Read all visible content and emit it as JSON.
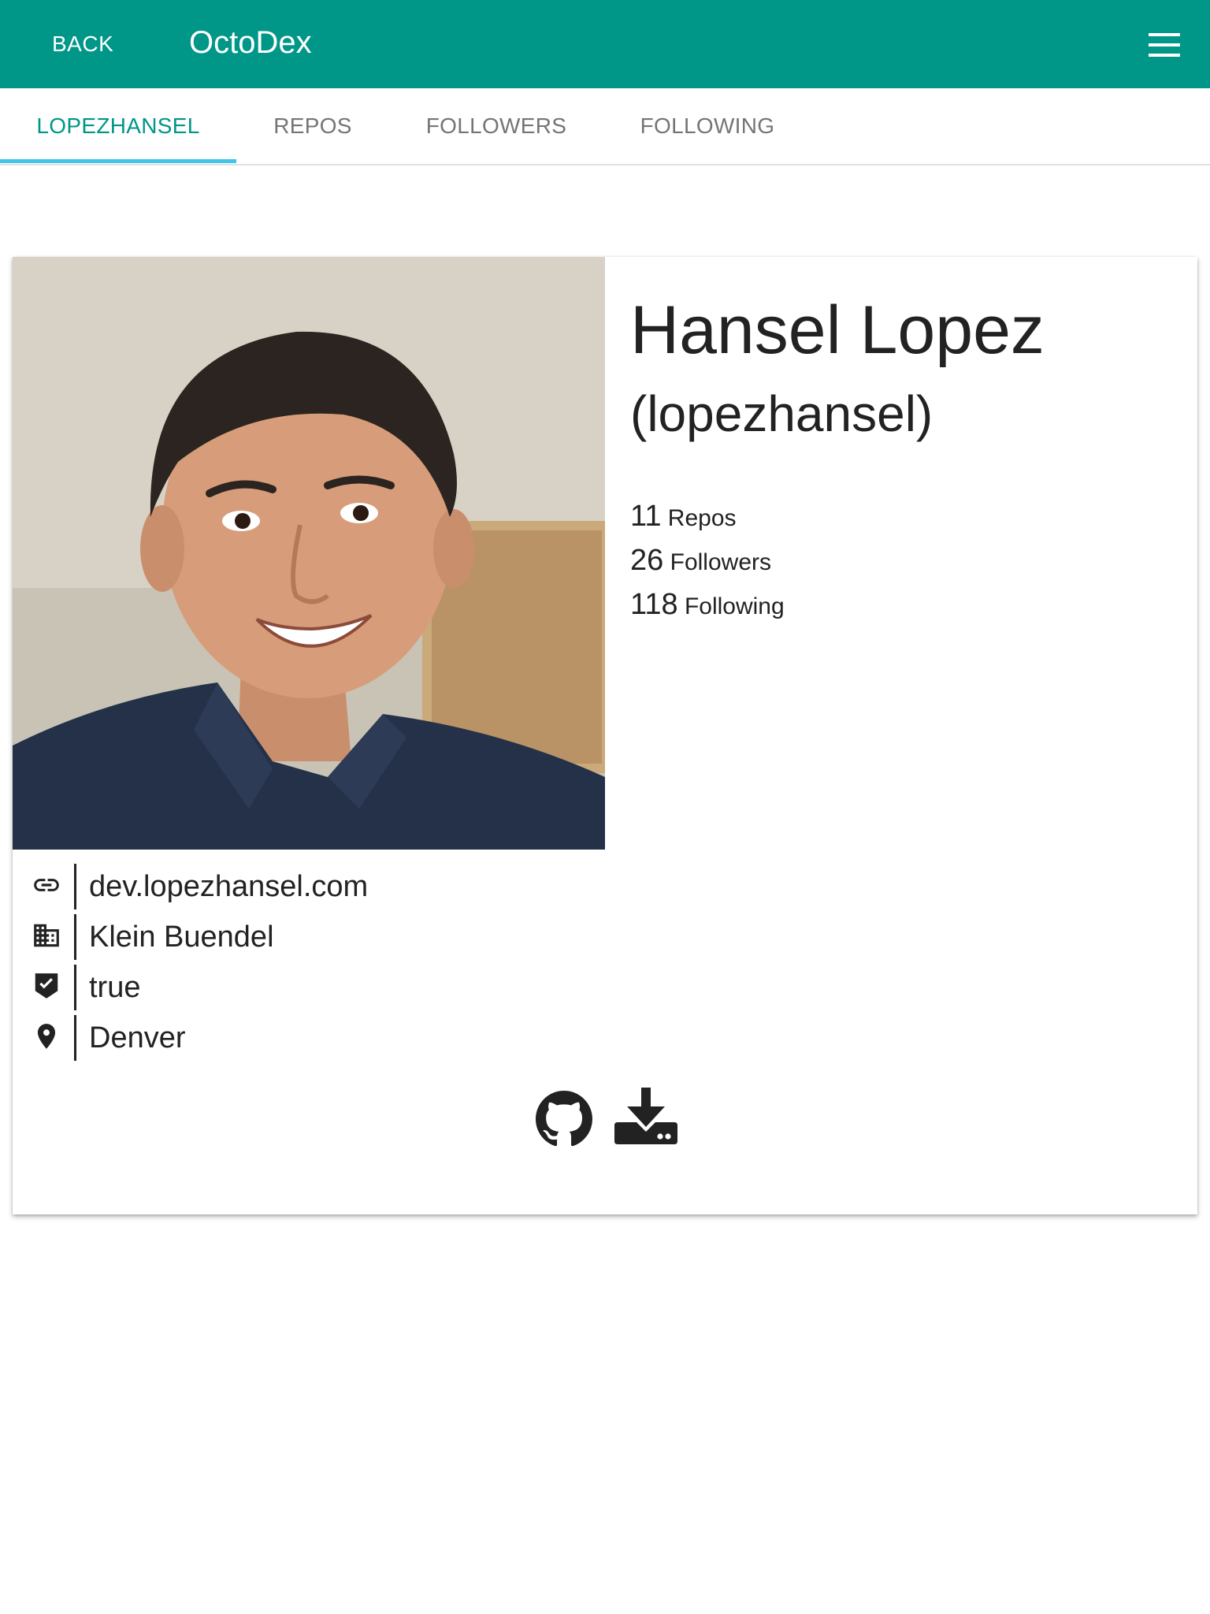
{
  "appbar": {
    "back_label": "BACK",
    "title": "OctoDex",
    "menu_icon": "hamburger-menu-icon"
  },
  "tabs": [
    {
      "label": "LOPEZHANSEL",
      "active": true
    },
    {
      "label": "REPOS",
      "active": false
    },
    {
      "label": "FOLLOWERS",
      "active": false
    },
    {
      "label": "FOLLOWING",
      "active": false
    }
  ],
  "colors": {
    "primary": "#009688",
    "tab_indicator": "#40c4e8",
    "tab_inactive": "#757575"
  },
  "profile": {
    "name": "Hansel Lopez",
    "login": "(lopezhansel)",
    "stats": [
      {
        "count": "11",
        "label": "Repos"
      },
      {
        "count": "26",
        "label": "Followers"
      },
      {
        "count": "118",
        "label": "Following"
      }
    ],
    "details": [
      {
        "icon": "link-icon",
        "text": "dev.lopezhansel.com"
      },
      {
        "icon": "building-icon",
        "text": "Klein Buendel"
      },
      {
        "icon": "verified-shield-icon",
        "text": "true"
      },
      {
        "icon": "location-pin-icon",
        "text": "Denver"
      }
    ],
    "actions": [
      {
        "icon": "github-icon"
      },
      {
        "icon": "download-icon"
      }
    ]
  }
}
